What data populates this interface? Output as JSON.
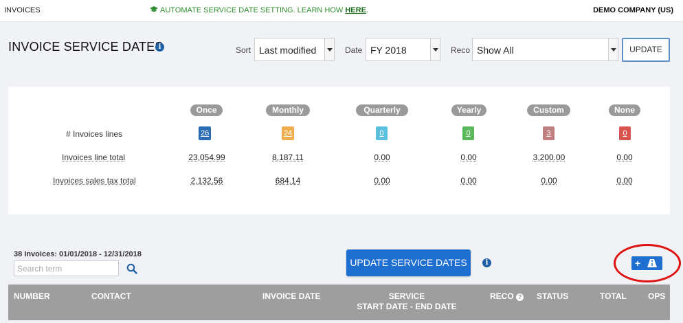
{
  "topbar": {
    "app_title": "INVOICES",
    "promo_text": "AUTOMATE SERVICE DATE SETTING. LEARN HOW ",
    "promo_link": "HERE",
    "promo_end": ".",
    "company": "DEMO COMPANY (US)"
  },
  "page": {
    "title": "INVOICE SERVICE DATES"
  },
  "filters": {
    "sort_label": "Sort",
    "sort_value": "Last modified",
    "date_label": "Date",
    "date_value": "FY 2018",
    "reco_label": "Reco",
    "reco_value": "Show All",
    "update_label": "UPDATE"
  },
  "summary": {
    "row_labels": [
      "# Invoices lines",
      "Invoices line total",
      "Invoices sales tax total"
    ],
    "columns": [
      {
        "name": "Once",
        "count": "26",
        "color": "#2a6db4",
        "line_total": "23,054.99",
        "tax_total": "2,132.56"
      },
      {
        "name": "Monthly",
        "count": "24",
        "color": "#f0ad4e",
        "line_total": "8,187.11",
        "tax_total": "684.14"
      },
      {
        "name": "Quarterly",
        "count": "0",
        "color": "#5bc0de",
        "line_total": "0.00",
        "tax_total": "0.00"
      },
      {
        "name": "Yearly",
        "count": "0",
        "color": "#5cb85c",
        "line_total": "0.00",
        "tax_total": "0.00"
      },
      {
        "name": "Custom",
        "count": "3",
        "color": "#c08080",
        "line_total": "3,200.00",
        "tax_total": "0.00"
      },
      {
        "name": "None",
        "count": "0",
        "color": "#d9534f",
        "line_total": "0.00",
        "tax_total": "0.00"
      }
    ]
  },
  "list": {
    "count_text": "38 Invoices: 01/01/2018 - 12/31/2018",
    "search_placeholder": "Search term",
    "update_service_dates_label": "UPDATE SERVICE DATES"
  },
  "table": {
    "number": "NUMBER",
    "contact": "CONTACT",
    "invoice_date": "INVOICE DATE",
    "service_line1": "SERVICE",
    "service_line2": "START DATE - END DATE",
    "reco": "RECO",
    "status": "STATUS",
    "total": "TOTAL",
    "ops": "OPS"
  },
  "icons": {
    "info": "info-circle-icon",
    "search": "search-icon",
    "add_rule": "plus-road-icon",
    "promo": "graduation-cap-icon",
    "help": "question-circle-icon"
  },
  "colors": {
    "primary_button": "#1f6fd1",
    "table_header": "#9e9e9e",
    "promo_text": "#2e8b2e",
    "highlight_ring": "#e01111"
  }
}
